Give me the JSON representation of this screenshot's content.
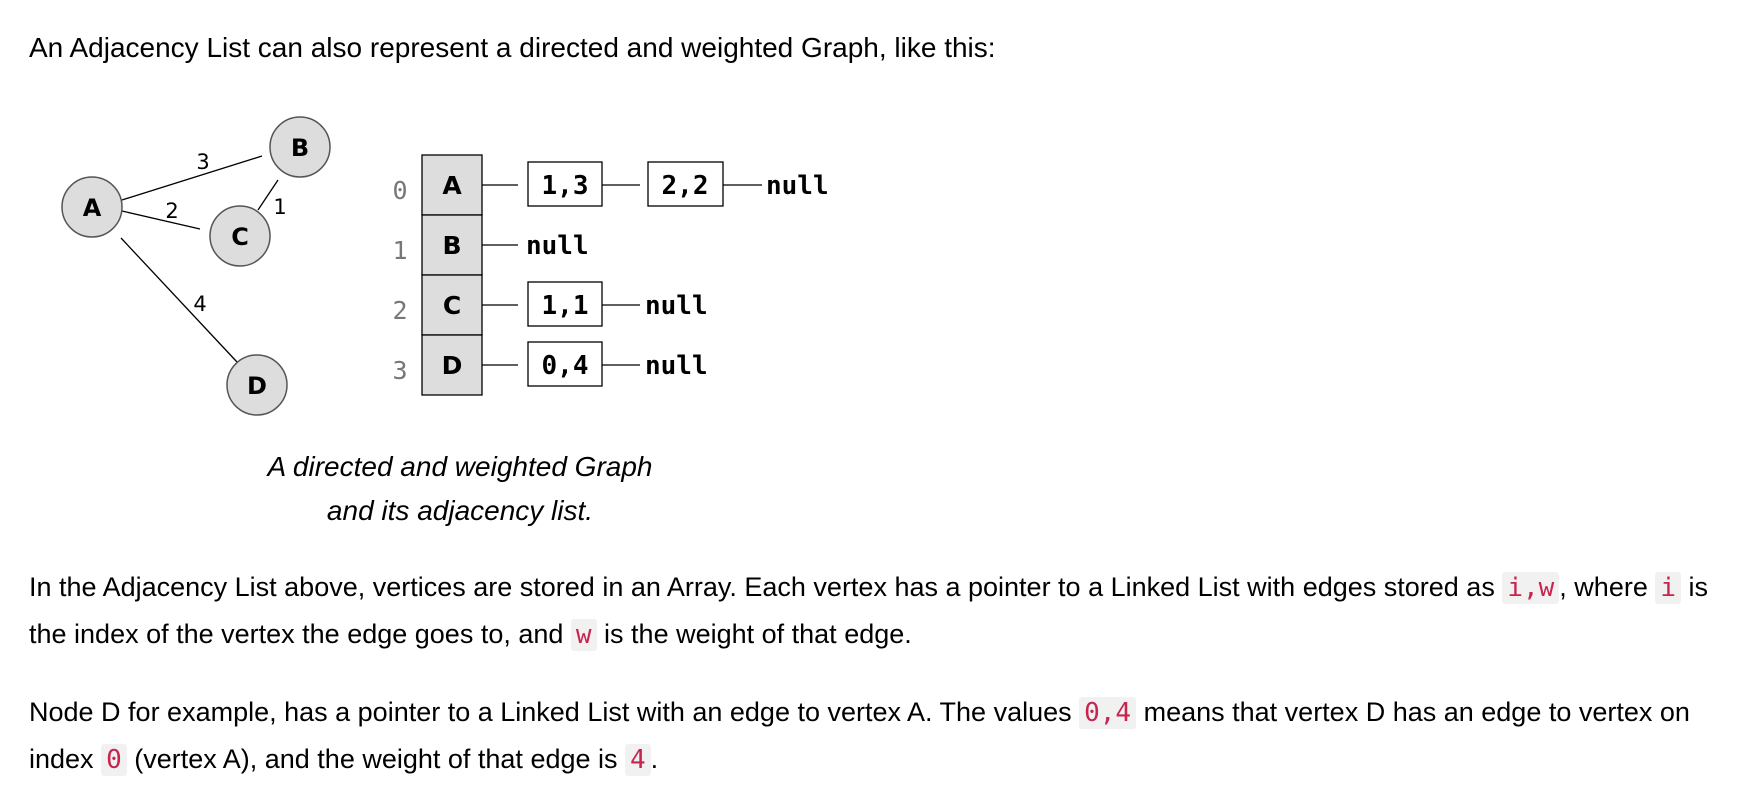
{
  "intro": "An Adjacency List can also represent a directed and weighted Graph, like this:",
  "graph": {
    "nodes": [
      "A",
      "B",
      "C",
      "D"
    ],
    "edge_weights": [
      "3",
      "2",
      "1",
      "4"
    ]
  },
  "adjacency": {
    "indices": [
      "0",
      "1",
      "2",
      "3"
    ],
    "vertices": [
      "A",
      "B",
      "C",
      "D"
    ],
    "row0": [
      "1,3",
      "2,2",
      "null"
    ],
    "row1": [
      "null"
    ],
    "row2": [
      "1,1",
      "null"
    ],
    "row3": [
      "0,4",
      "null"
    ]
  },
  "caption": {
    "line1": "A directed and weighted Graph",
    "line2": "and its adjacency list."
  },
  "paragraph1": {
    "t1": "In the Adjacency List above, vertices are stored in an Array. Each vertex has a pointer to a Linked List with edges stored as ",
    "c1": "i,w",
    "t2": ", where ",
    "c2": "i",
    "t3": " is the index of the vertex the edge goes to, and ",
    "c3": "w",
    "t4": " is the weight of that edge."
  },
  "paragraph2": {
    "t1": "Node D for example, has a pointer to a Linked List with an edge to vertex A. The values ",
    "c1": "0,4",
    "t2": " means that vertex D has an edge to vertex on index ",
    "c2": "0",
    "t3": " (vertex A), and the weight of that edge is ",
    "c3": "4",
    "t4": "."
  },
  "colors": {
    "node_fill": "#dddddd",
    "code_text": "#c7254e",
    "code_bg": "#f1f1f1"
  }
}
